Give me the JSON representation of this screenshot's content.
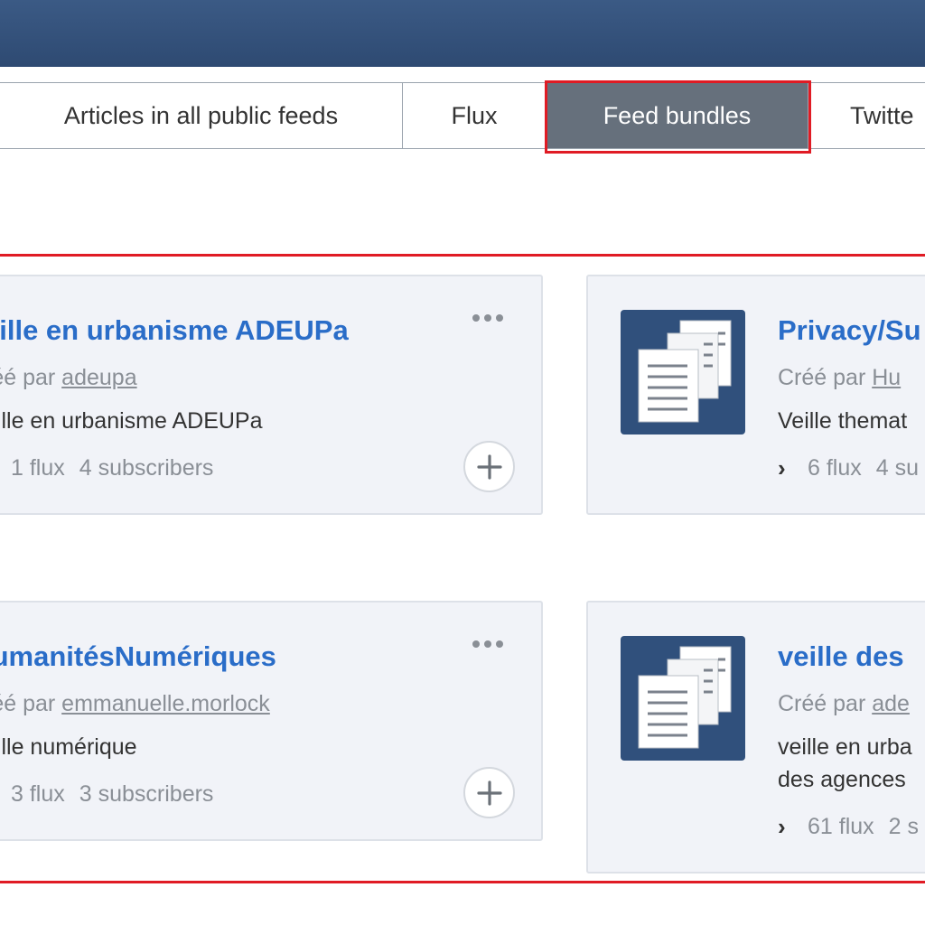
{
  "tabs": [
    {
      "label": "Articles in all public feeds"
    },
    {
      "label": "Flux"
    },
    {
      "label": "Feed bundles"
    },
    {
      "label": "Twitte"
    }
  ],
  "cards": [
    {
      "title": "eille en urbanisme ADEUPa",
      "created_by": "réé par",
      "author": "adeupa",
      "description": [
        "eille en urbanisme ADEUPa"
      ],
      "feeds": "1 flux",
      "subscribers": "4 subscribers"
    },
    {
      "title": "Privacy/Su",
      "created_by": "Créé par",
      "author": "Hu",
      "description": [
        "Veille themat"
      ],
      "feeds": "6 flux",
      "subscribers": "4 su"
    },
    {
      "title": "lumanitésNumériques",
      "created_by": "réé par",
      "author": "emmanuelle.morlock",
      "description": [
        "eille numérique"
      ],
      "feeds": "3 flux",
      "subscribers": "3 subscribers"
    },
    {
      "title": "veille des",
      "created_by": "Créé par",
      "author": "ade",
      "description": [
        "veille en urba",
        "des agences"
      ],
      "feeds": "61 flux",
      "subscribers": "2 s"
    }
  ],
  "icons": {
    "more": "more-options-icon",
    "add": "plus-icon",
    "expand": "chevron-right-icon",
    "bundle": "documents-icon"
  },
  "colors": {
    "header": "#2e4a72",
    "active_tab": "#66707c",
    "link": "#2a6dc8",
    "highlight": "#e01b24"
  }
}
